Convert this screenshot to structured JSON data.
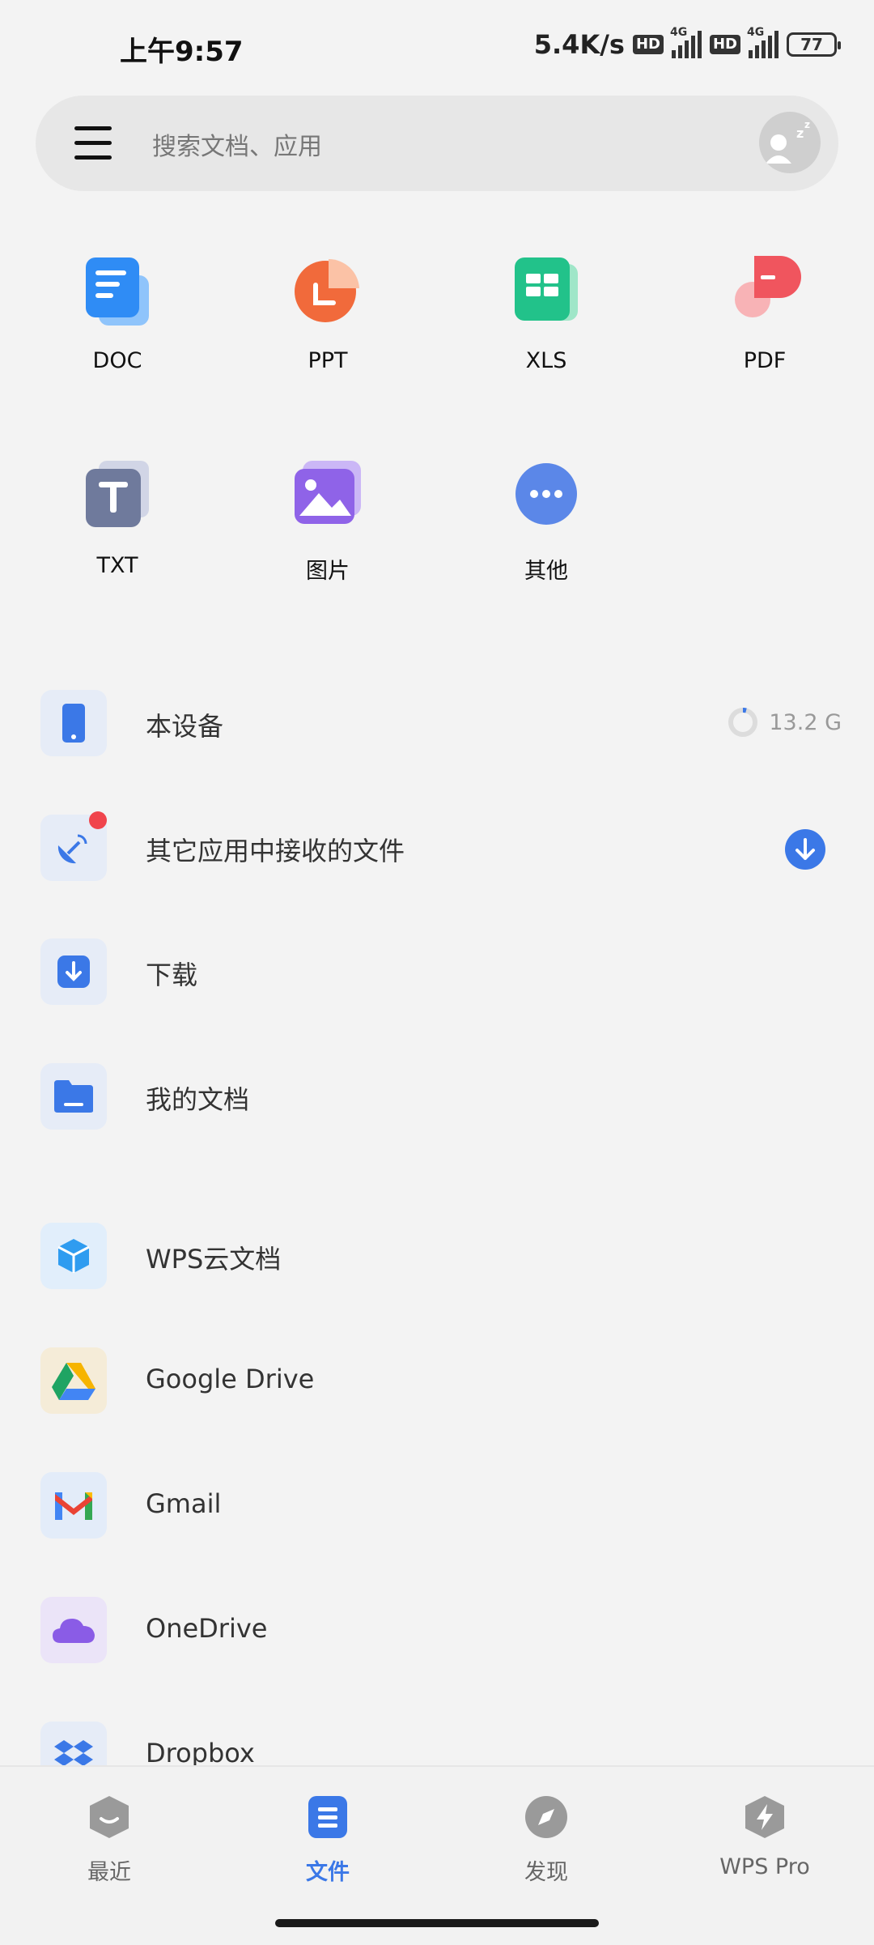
{
  "status_bar": {
    "time": "上午9:57",
    "speed": "5.4K/s",
    "hd": "HD",
    "net": "4G",
    "battery": "77"
  },
  "search": {
    "placeholder": "搜索文档、应用"
  },
  "categories": [
    {
      "label": "DOC",
      "icon": "doc-icon",
      "color": "#2f8cf5"
    },
    {
      "label": "PPT",
      "icon": "ppt-icon",
      "color": "#f16a3b"
    },
    {
      "label": "XLS",
      "icon": "xls-icon",
      "color": "#22c28a"
    },
    {
      "label": "PDF",
      "icon": "pdf-icon",
      "color": "#f0555e"
    },
    {
      "label": "TXT",
      "icon": "txt-icon",
      "color": "#6f7a9c"
    },
    {
      "label": "图片",
      "icon": "image-icon",
      "color": "#8f63e8"
    },
    {
      "label": "其他",
      "icon": "more-icon",
      "color": "#5b87e8"
    }
  ],
  "locations": [
    {
      "label": "本设备",
      "icon": "phone-icon",
      "storage": "13.2 G"
    },
    {
      "label": "其它应用中接收的文件",
      "icon": "satellite-icon"
    },
    {
      "label": "下载",
      "icon": "download-icon"
    },
    {
      "label": "我的文档",
      "icon": "folder-icon"
    }
  ],
  "cloud": [
    {
      "label": "WPS云文档",
      "icon": "wps-cloud-icon"
    },
    {
      "label": "Google Drive",
      "icon": "google-drive-icon"
    },
    {
      "label": "Gmail",
      "icon": "gmail-icon"
    },
    {
      "label": "OneDrive",
      "icon": "onedrive-icon"
    },
    {
      "label": "Dropbox",
      "icon": "dropbox-icon"
    }
  ],
  "bottom_nav": [
    {
      "label": "最近",
      "icon": "recent-icon",
      "active": false
    },
    {
      "label": "文件",
      "icon": "files-icon",
      "active": true
    },
    {
      "label": "发现",
      "icon": "discover-icon",
      "active": false
    },
    {
      "label": "WPS Pro",
      "icon": "wps-pro-icon",
      "active": false
    }
  ],
  "colors": {
    "accent": "#3b78e7",
    "background": "#f3f3f3",
    "badge": "#f0444c"
  }
}
